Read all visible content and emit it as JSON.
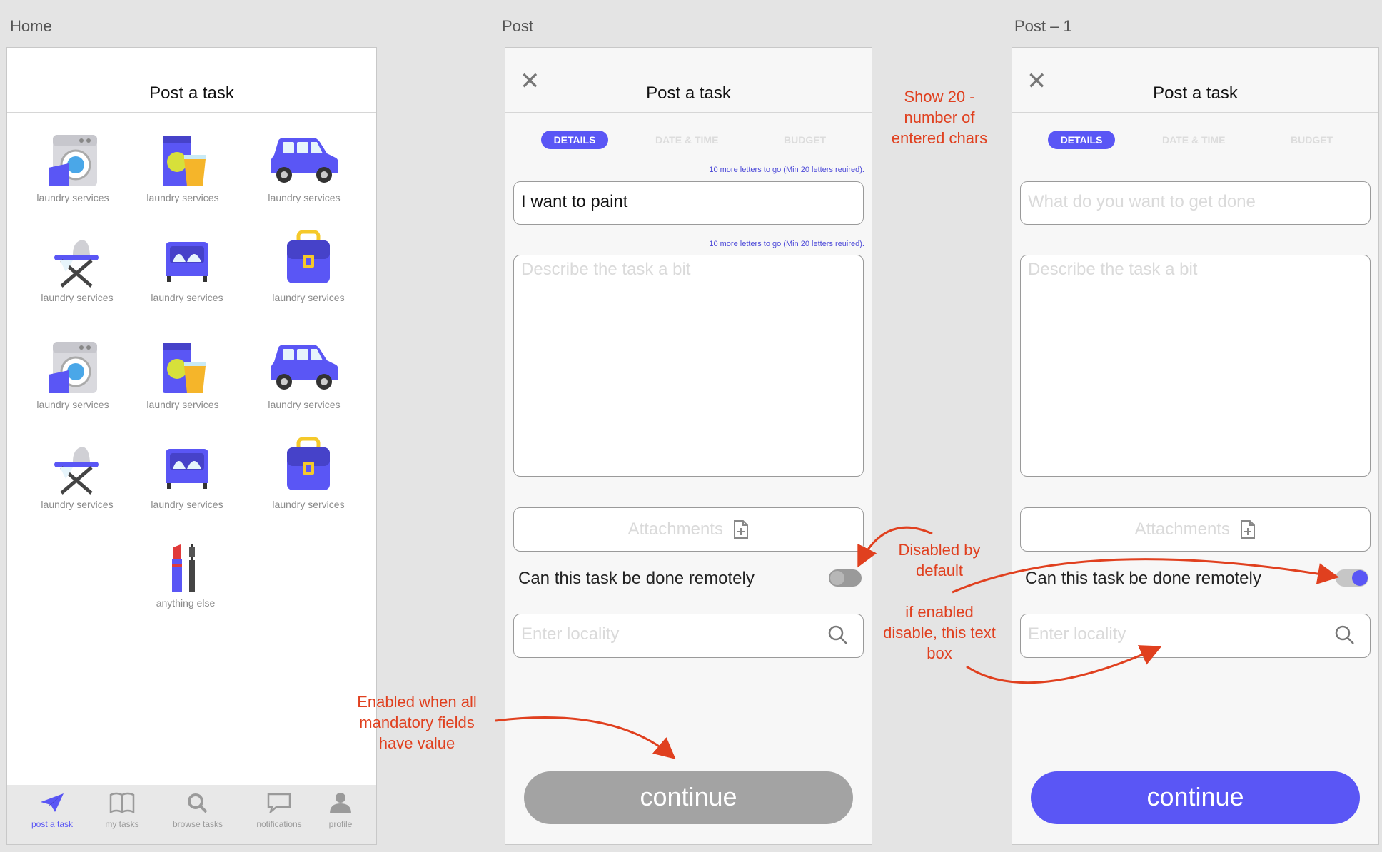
{
  "artboards": {
    "home": "Home",
    "post": "Post",
    "post1": "Post – 1"
  },
  "home": {
    "title": "Post a task",
    "categories": [
      {
        "label": "laundry services",
        "icon": "washing-machine-icon"
      },
      {
        "label": "laundry services",
        "icon": "detergent-icon"
      },
      {
        "label": "laundry services",
        "icon": "car-icon"
      },
      {
        "label": "laundry services",
        "icon": "ironing-board-icon"
      },
      {
        "label": "laundry services",
        "icon": "bed-icon"
      },
      {
        "label": "laundry services",
        "icon": "briefcase-icon"
      },
      {
        "label": "laundry services",
        "icon": "washing-machine-icon"
      },
      {
        "label": "laundry services",
        "icon": "detergent-icon"
      },
      {
        "label": "laundry services",
        "icon": "car-icon"
      },
      {
        "label": "laundry services",
        "icon": "ironing-board-icon"
      },
      {
        "label": "laundry services",
        "icon": "bed-icon"
      },
      {
        "label": "laundry services",
        "icon": "briefcase-icon"
      },
      {
        "label": "anything else",
        "icon": "lipstick-icon"
      }
    ],
    "tabbar": [
      {
        "label": "post a task",
        "icon": "paper-plane-icon",
        "active": true
      },
      {
        "label": "my tasks",
        "icon": "book-icon",
        "active": false
      },
      {
        "label": "browse tasks",
        "icon": "search-icon",
        "active": false
      },
      {
        "label": "notifications",
        "icon": "chat-bubble-icon",
        "active": false
      },
      {
        "label": "profile",
        "icon": "person-icon",
        "active": false
      }
    ]
  },
  "post": {
    "title": "Post a task",
    "tabs": [
      "DETAILS",
      "DATE & TIME",
      "BUDGET"
    ],
    "hint": "10 more letters to go (Min 20 letters reuired).",
    "title_value": "I want to paint",
    "description_placeholder": "Describe the task a bit",
    "attachments": "Attachments",
    "remote_label": "Can this task be done remotely",
    "remote_enabled": false,
    "locality_placeholder": "Enter locality",
    "continue": "continue"
  },
  "post1": {
    "title": "Post a task",
    "tabs": [
      "DETAILS",
      "DATE & TIME",
      "BUDGET"
    ],
    "title_placeholder": "What do you want to get done",
    "description_placeholder": "Describe the task a bit",
    "attachments": "Attachments",
    "remote_label": "Can this task be done remotely",
    "remote_enabled": true,
    "locality_placeholder": "Enter locality",
    "continue": "continue"
  },
  "annotations": {
    "char_count": "Show 20 - number of entered chars",
    "disabled_default": "Disabled by default",
    "if_enabled": "if enabled disable, this text box",
    "enabled_when": "Enabled when all mandatory fields have value"
  },
  "colors": {
    "accent": "#5a56f5",
    "annotation": "#e0401f",
    "disabled": "#a3a3a3"
  }
}
